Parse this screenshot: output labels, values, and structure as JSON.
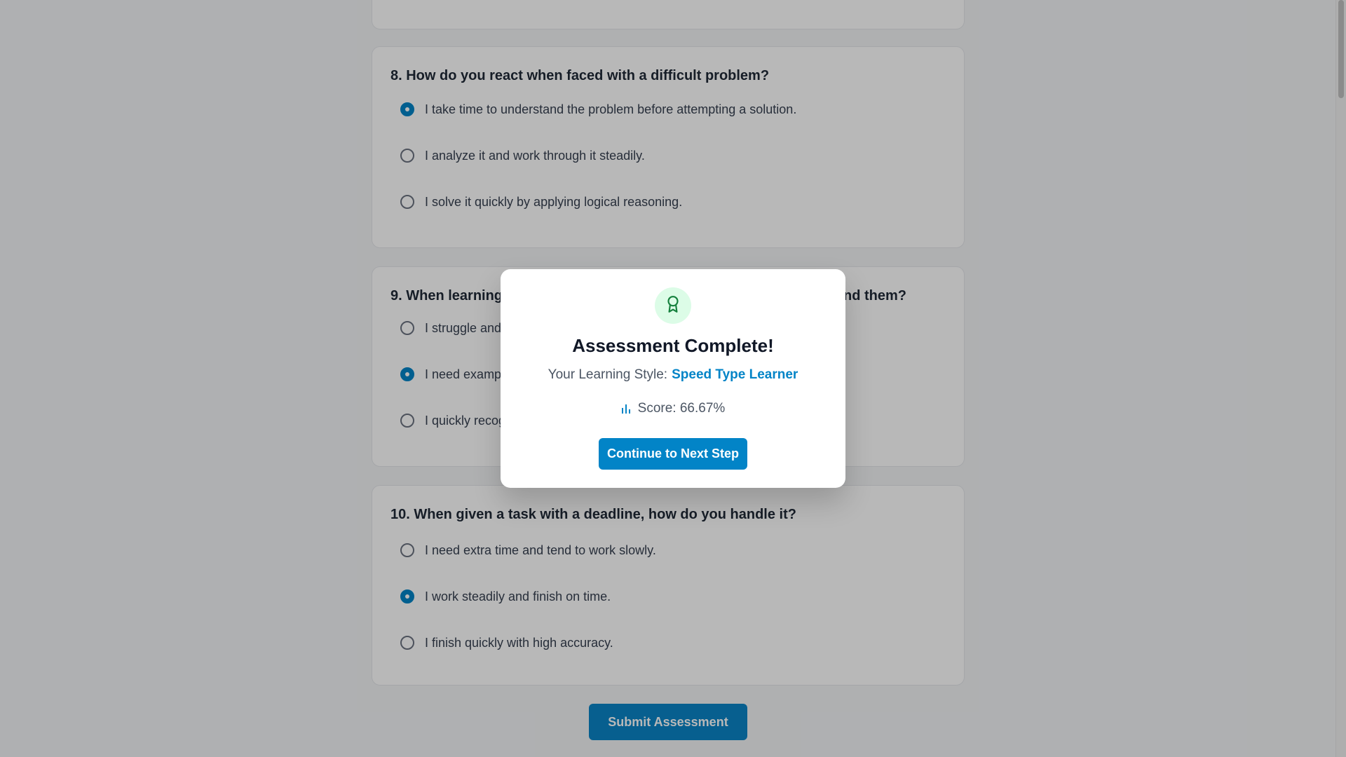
{
  "questions": [
    {
      "number": "8.",
      "title": "8. How do you react when faced with a difficult problem?",
      "options": [
        {
          "label": "I take time to understand the problem before attempting a solution.",
          "selected": true
        },
        {
          "label": "I analyze it and work through it steadily.",
          "selected": false
        },
        {
          "label": "I solve it quickly by applying logical reasoning.",
          "selected": false
        }
      ]
    },
    {
      "number": "9.",
      "title_visible_left": "9. When learning",
      "title_visible_right": "nd them?",
      "options": [
        {
          "label_visible": "I struggle and",
          "selected": false
        },
        {
          "label_visible": "I need exampl",
          "selected": true
        },
        {
          "label_visible": "I quickly recog",
          "selected": false
        }
      ]
    },
    {
      "number": "10.",
      "title": "10. When given a task with a deadline, how do you handle it?",
      "options": [
        {
          "label": "I need extra time and tend to work slowly.",
          "selected": false
        },
        {
          "label": "I work steadily and finish on time.",
          "selected": true
        },
        {
          "label": "I finish quickly with high accuracy.",
          "selected": false
        }
      ]
    }
  ],
  "submit_label": "Submit Assessment",
  "modal": {
    "icon": "award-icon",
    "title": "Assessment Complete!",
    "learning_style_label": "Your Learning Style:",
    "learning_style_value": "Speed Type Learner",
    "score_icon": "bar-chart-icon",
    "score_text": "Score: 66.67%",
    "continue_label": "Continue to Next Step"
  },
  "colors": {
    "accent": "#0284c7",
    "icon_bg": "#dcfce7",
    "icon_stroke": "#15803d"
  }
}
